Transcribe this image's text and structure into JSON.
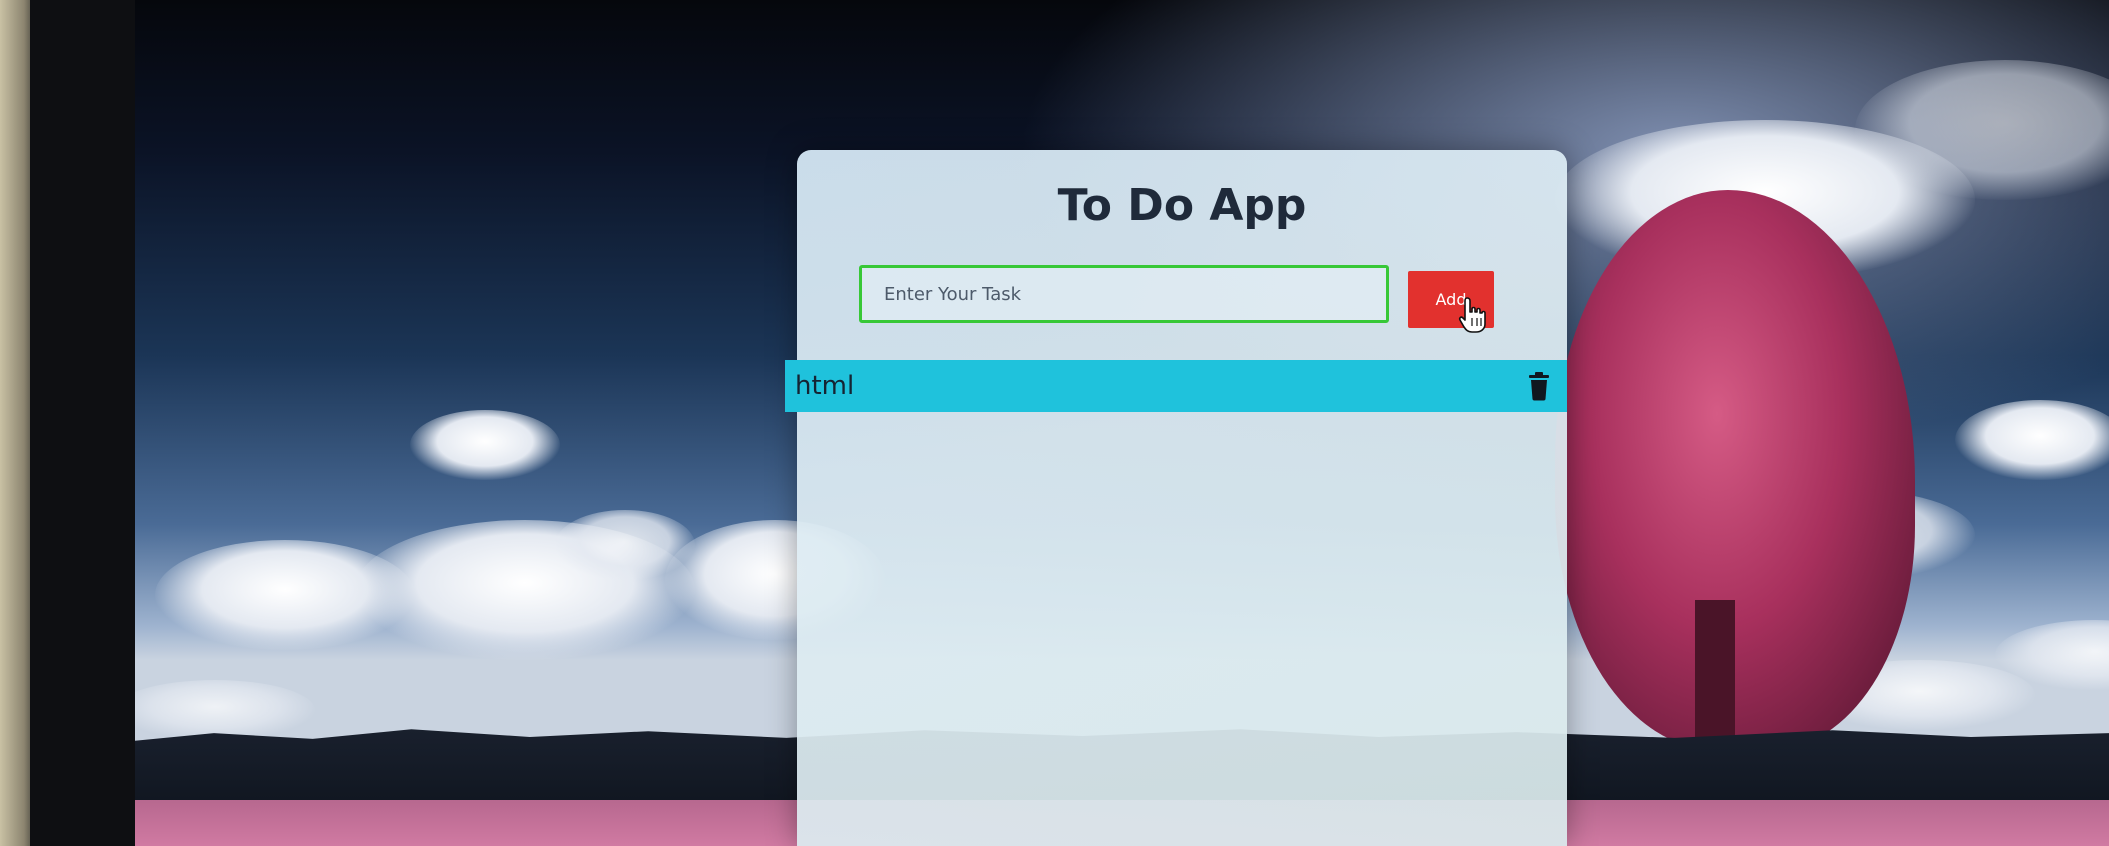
{
  "app": {
    "title": "To Do App",
    "input": {
      "value": "",
      "placeholder": "Enter Your Task"
    },
    "add_button_label": "Add",
    "tasks": [
      {
        "label": "html"
      }
    ]
  },
  "colors": {
    "input_border": "#37c837",
    "add_button": "#e2312e",
    "task_row": "#1fc2dc",
    "title_text": "#1f2a3a"
  },
  "icons": {
    "delete": "trash-icon",
    "pointer": "hand-pointer-icon"
  }
}
